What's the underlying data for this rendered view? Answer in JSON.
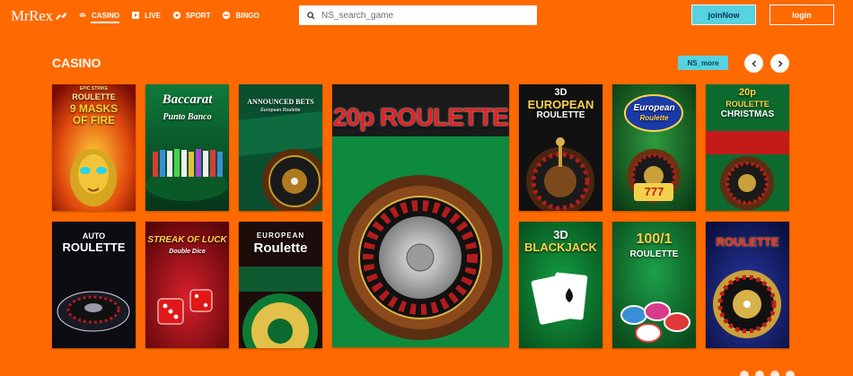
{
  "header": {
    "logo": "MrRex",
    "nav": [
      {
        "label": "CASINO",
        "icon": "cards-icon",
        "active": true
      },
      {
        "label": "LIVE",
        "icon": "live-icon",
        "active": false
      },
      {
        "label": "SPORT",
        "icon": "ball-icon",
        "active": false
      },
      {
        "label": "BINGO",
        "icon": "bingo-icon",
        "active": false
      }
    ],
    "search_placeholder": "NS_search_game",
    "join_label": "joinNow",
    "login_label": "login"
  },
  "section": {
    "title": "CASINO",
    "more_label": "NS_more"
  },
  "games": [
    {
      "title": "ROULETTE 9 MASKS OF FIRE",
      "eyebrow": "EPIC STRIKE",
      "line1": "ROULETTE",
      "line2": "9 MASKS",
      "line3": "OF FIRE"
    },
    {
      "title": "Baccarat Punto Banco",
      "line1": "Baccarat",
      "line2": "Punto Banco"
    },
    {
      "title": "ANNOUNCED BETS European Roulette",
      "line1": "ANNOUNCED BETS",
      "line2": "European Roulette"
    },
    {
      "title": "20p ROULETTE",
      "line1": "20p ROULETTE"
    },
    {
      "title": "3D EUROPEAN ROULETTE",
      "line1": "3D",
      "line2": "EUROPEAN",
      "line3": "ROULETTE"
    },
    {
      "title": "European Roulette",
      "line1": "European",
      "line2": "Roulette",
      "badge": "777"
    },
    {
      "title": "20p ROULETTE CHRISTMAS",
      "line1": "20p",
      "line2": "ROULETTE",
      "line3": "CHRISTMAS"
    },
    {
      "title": "AUTO ROULETTE",
      "line1": "AUTO",
      "line2": "ROULETTE"
    },
    {
      "title": "STREAK OF LUCK Double Dice",
      "line1": "STREAK OF LUCK",
      "line2": "Double Dice"
    },
    {
      "title": "EUROPEAN Roulette",
      "line1": "EUROPEAN",
      "line2": "Roulette"
    },
    {
      "title": "3D BLACKJACK",
      "line1": "3D",
      "line2": "BLACKJACK"
    },
    {
      "title": "100/1 ROULETTE",
      "line1": "100/1",
      "line2": "ROULETTE"
    },
    {
      "title": "ROULETTE",
      "line1": "ROULETTE"
    }
  ],
  "colors": {
    "background": "#fe6a00",
    "accent": "#56d2e0",
    "text": "#ffffff"
  }
}
